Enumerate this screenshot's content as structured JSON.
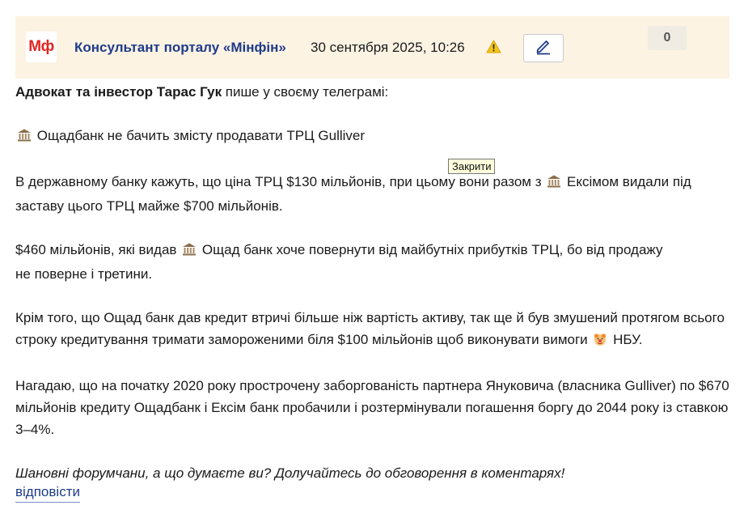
{
  "header": {
    "logo_text": "Мф",
    "author": "Консультант порталу «Мінфін»",
    "date": "30 сентября 2025, 10:26",
    "warning_icon": "warning-icon",
    "edit_icon": "pencil-icon",
    "counter": "0"
  },
  "tooltip": {
    "text": "Закрити"
  },
  "post": {
    "intro_bold": "Адвокат та інвестор Тарас Гук",
    "intro_rest": " пише у своєму телеграмі:",
    "p1": "Ощадбанк не бачить змісту продавати ТРЦ Gulliver",
    "p2a": "В державному банку кажуть, що ціна ТРЦ $130 мільйонів, при цьому вони разом з",
    "p2b": "Ексімом видали під заставу цього ТРЦ майже $700 мільйонів.",
    "p3a": "$460 мільйонів, які видав",
    "p3b": "Ощад банк хоче повернути від майбутніх прибутків ТРЦ, бо від продажу",
    "p3c": "не поверне і третини.",
    "p4a": "Крім того, що Ощад банк дав кредит втричі більше ніж вартість активу, так ще й був змушений протягом всього строку кредитування тримати замороженими біля $100 мільйонів щоб виконувати вимоги",
    "p4b": "НБУ.",
    "p5": "Нагадаю, що на початку 2020 року прострочену заборгованість партнера Януковича (власника Gulliver) по $670 мільйонів кредиту Ощадбанк і Ексім банк пробачили і розтермінували погашення боргу до 2044 року із ставкою 3–4%.",
    "closing": "Шановні форумчани, а що думаєте ви? Долучайтесь до обговорення в коментарях!"
  },
  "footer": {
    "reply_label": "відповісти"
  }
}
